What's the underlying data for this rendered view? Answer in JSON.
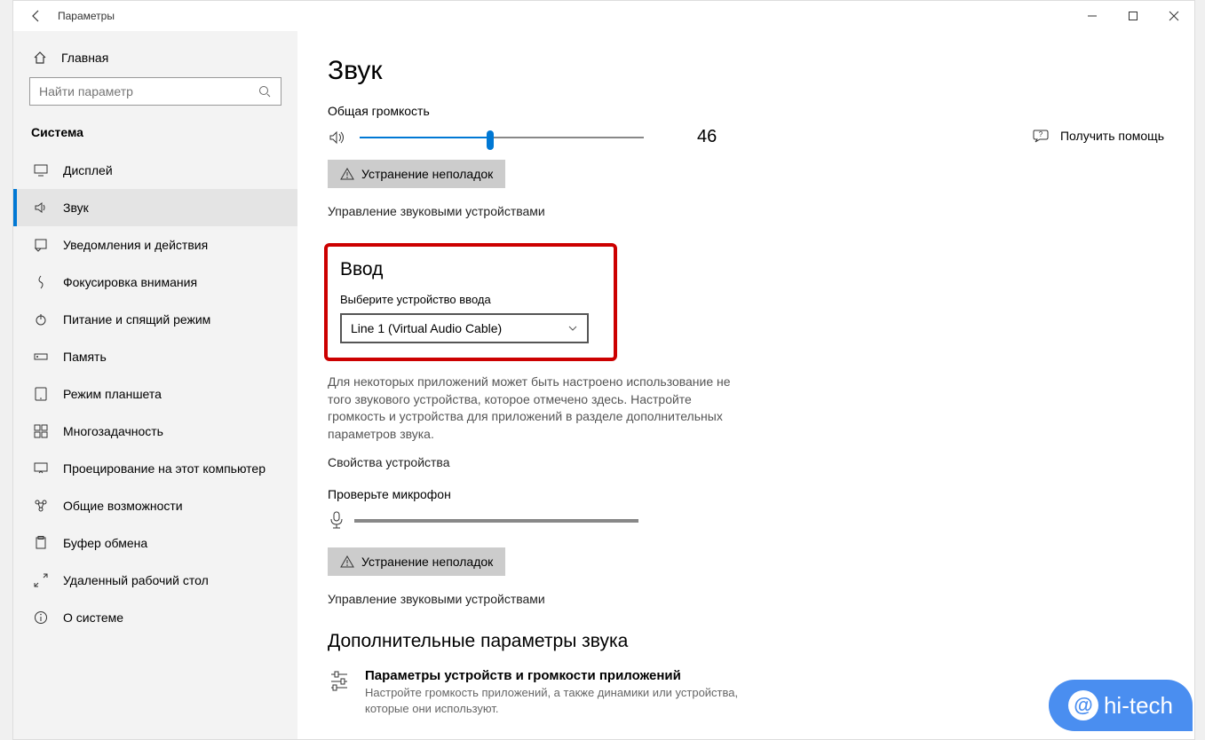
{
  "window": {
    "title": "Параметры"
  },
  "sidebar": {
    "home": "Главная",
    "search_placeholder": "Найти параметр",
    "group": "Система",
    "items": [
      {
        "icon": "display",
        "label": "Дисплей"
      },
      {
        "icon": "sound",
        "label": "Звук"
      },
      {
        "icon": "notify",
        "label": "Уведомления и действия"
      },
      {
        "icon": "focus",
        "label": "Фокусировка внимания"
      },
      {
        "icon": "power",
        "label": "Питание и спящий режим"
      },
      {
        "icon": "storage",
        "label": "Память"
      },
      {
        "icon": "tablet",
        "label": "Режим планшета"
      },
      {
        "icon": "multitask",
        "label": "Многозадачность"
      },
      {
        "icon": "project",
        "label": "Проецирование на этот компьютер"
      },
      {
        "icon": "shared",
        "label": "Общие возможности"
      },
      {
        "icon": "clipboard",
        "label": "Буфер обмена"
      },
      {
        "icon": "remote",
        "label": "Удаленный рабочий стол"
      },
      {
        "icon": "about",
        "label": "О системе"
      }
    ],
    "active_index": 1
  },
  "main": {
    "title": "Звук",
    "volume_label": "Общая громкость",
    "volume_value": "46",
    "troubleshoot": "Устранение неполадок",
    "manage_devices": "Управление звуковыми устройствами",
    "input": {
      "heading": "Ввод",
      "choose_label": "Выберите устройство ввода",
      "selected": "Line 1 (Virtual Audio Cable)",
      "note": "Для некоторых приложений может быть настроено использование не того звукового устройства, которое отмечено здесь. Настройте громкость и устройства для приложений в разделе дополнительных параметров звука.",
      "properties": "Свойства устройства",
      "test_mic": "Проверьте микрофон",
      "troubleshoot": "Устранение неполадок",
      "manage_devices": "Управление звуковыми устройствами"
    },
    "advanced": {
      "heading": "Дополнительные параметры звука",
      "item_title": "Параметры устройств и громкости приложений",
      "item_desc": "Настройте громкость приложений, а также динамики или устройства, которые они используют."
    },
    "help": "Получить помощь"
  },
  "watermark": "hi-tech"
}
